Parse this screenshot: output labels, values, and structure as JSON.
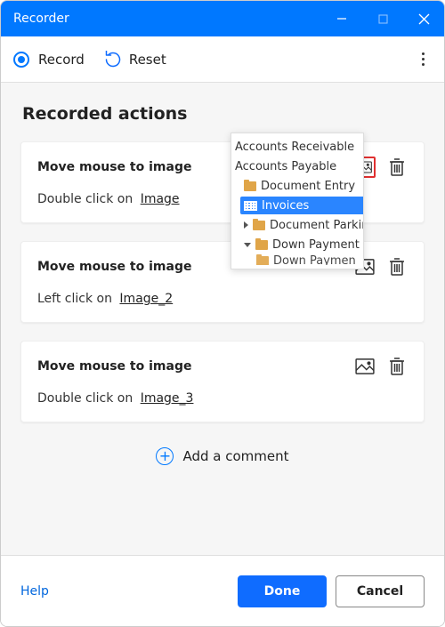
{
  "window": {
    "title": "Recorder"
  },
  "toolbar": {
    "record_label": "Record",
    "reset_label": "Reset"
  },
  "section": {
    "title": "Recorded actions"
  },
  "actions": [
    {
      "title": "Move mouse to image",
      "desc_prefix": "Double click on",
      "desc_link": "Image",
      "highlighted": true
    },
    {
      "title": "Move mouse to image",
      "desc_prefix": "Left click on",
      "desc_link": "Image_2",
      "highlighted": false
    },
    {
      "title": "Move mouse to image",
      "desc_prefix": "Double click on",
      "desc_link": "Image_3",
      "highlighted": false
    }
  ],
  "tree": {
    "items": [
      {
        "label": "Accounts Receivable",
        "level": 0,
        "icon": "none",
        "selected": false
      },
      {
        "label": "Accounts Payable",
        "level": 0,
        "icon": "none",
        "selected": false
      },
      {
        "label": "Document Entry",
        "level": 1,
        "icon": "folder",
        "expander": "down",
        "selected": false
      },
      {
        "label": "Invoices",
        "level": 1,
        "icon": "table",
        "selected": true
      },
      {
        "label": "Document Parkin",
        "level": 1,
        "icon": "folder",
        "expander": "right",
        "selected": false
      },
      {
        "label": "Down Payment",
        "level": 1,
        "icon": "folder",
        "expander": "down",
        "selected": false
      },
      {
        "label": "Down Paymen",
        "level": 1,
        "icon": "folder",
        "selected": false,
        "cut": true
      }
    ]
  },
  "add_comment": {
    "label": "Add a comment"
  },
  "footer": {
    "help": "Help",
    "done": "Done",
    "cancel": "Cancel"
  }
}
